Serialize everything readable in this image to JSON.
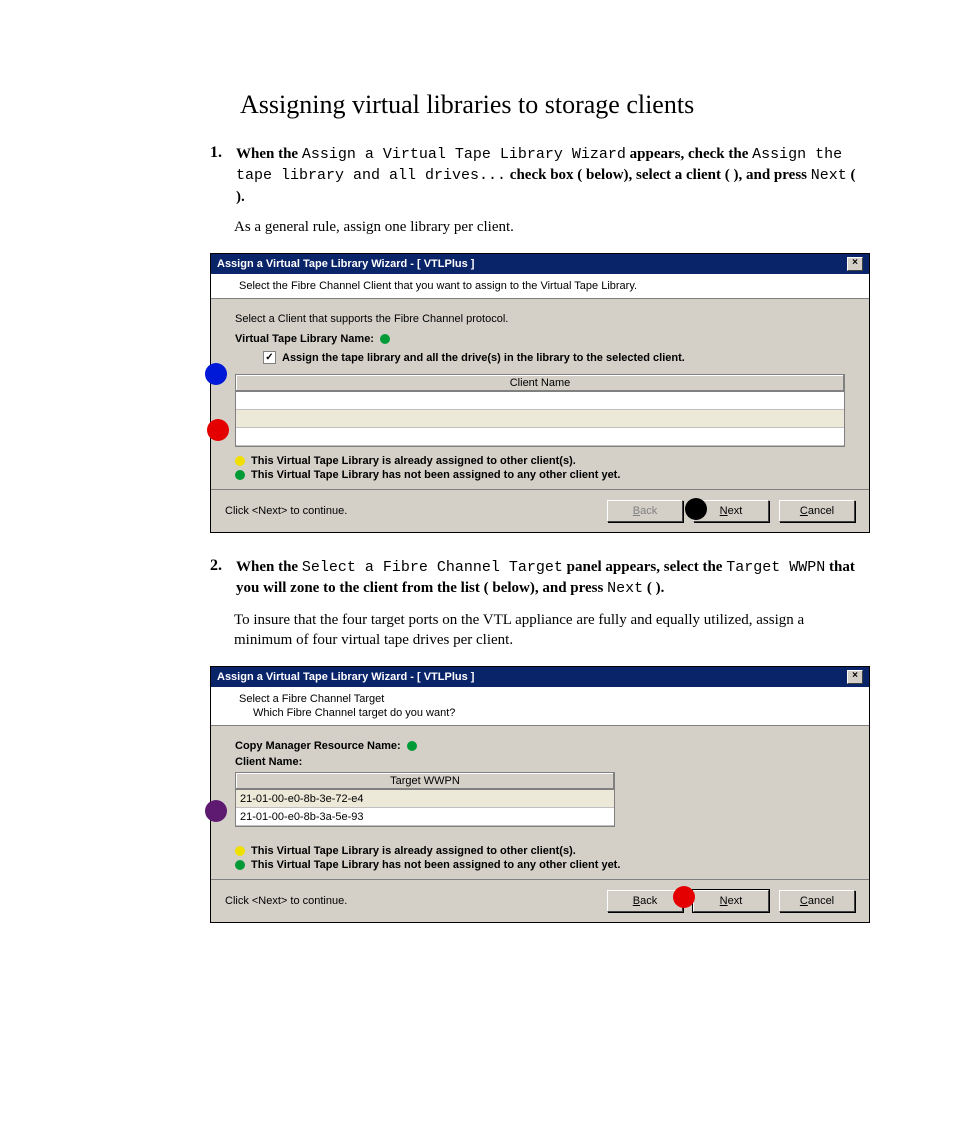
{
  "heading": "Assigning virtual libraries to storage clients",
  "step1": {
    "num": "1.",
    "t1": "When the ",
    "wizard_name": "Assign a Virtual Tape Library Wizard",
    "t2": " appears, check the ",
    "checkbox_text": "Assign the tape library and all drives...",
    "t3": " check box (",
    "t4": "  below), select a client (",
    "t5": "  ), and press ",
    "next_label": "Next",
    "t6": " (  ).",
    "note": "As a general rule, assign one library per client."
  },
  "dialog1": {
    "title": "Assign a Virtual Tape Library Wizard - [ VTLPlus ]",
    "sub": "Select the Fibre Channel Client that you want to assign to the Virtual Tape Library.",
    "instruct": "Select a Client that supports the Fibre Channel protocol.",
    "vtl_name_label": "Virtual Tape Library Name:",
    "chk_label": "Assign the tape library and all the drive(s) in the library to the selected client.",
    "col_header": "Client Name",
    "legend_yellow": "This Virtual Tape Library is already assigned to other client(s).",
    "legend_green": "This Virtual Tape Library has not been assigned to any other client yet.",
    "footer": "Click <Next> to continue.",
    "back": "Back",
    "next": "Next",
    "cancel": "Cancel"
  },
  "step2": {
    "num": "2.",
    "t1": "When the ",
    "panel_name": "Select a Fibre Channel Target",
    "t2": " panel appears, select the ",
    "target_mono": "Target WWPN",
    "t3": " that you will zone to the client from the list (",
    "t4": "   below), and press ",
    "next_label": "Next",
    "t5": " (  ).",
    "note": "To insure that the four target ports on the VTL appliance are fully and equally utilized, assign a minimum of four virtual tape drives per client."
  },
  "dialog2": {
    "title": "Assign a Virtual Tape Library Wizard - [ VTLPlus ]",
    "sh_title": "Select a Fibre Channel Target",
    "sh_sub": "Which Fibre Channel target do you want?",
    "cmrn_label": "Copy Manager Resource Name:",
    "client_label": "Client Name:",
    "col_header": "Target WWPN",
    "rows": {
      "r1": "21-01-00-e0-8b-3e-72-e4",
      "r2": "21-01-00-e0-8b-3a-5e-93"
    },
    "legend_yellow": "This Virtual Tape Library is already assigned to other client(s).",
    "legend_green": "This Virtual Tape Library has not been assigned to any other client yet.",
    "footer": "Click <Next> to continue.",
    "back": "Back",
    "next": "Next",
    "cancel": "Cancel"
  }
}
